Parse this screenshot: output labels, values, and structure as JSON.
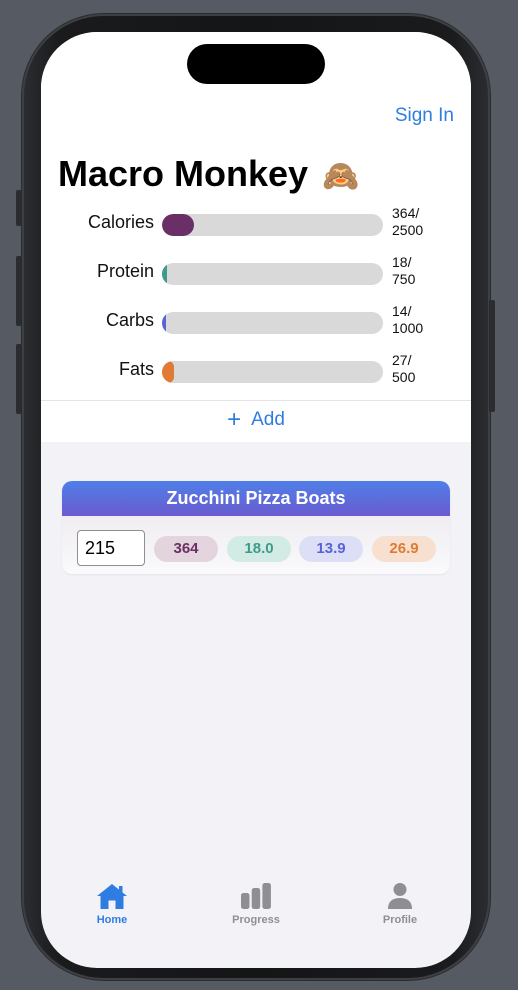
{
  "header": {
    "sign_in_label": "Sign In",
    "app_title": "Macro Monkey",
    "title_emoji": "🙈"
  },
  "macros": [
    {
      "label": "Calories",
      "current": 364,
      "goal": 2500,
      "value_line1": "364/",
      "value_line2": "2500",
      "color": "#6a2f66"
    },
    {
      "label": "Protein",
      "current": 18,
      "goal": 750,
      "value_line1": "18/",
      "value_line2": "750",
      "color": "#3f9a8d"
    },
    {
      "label": "Carbs",
      "current": 14,
      "goal": 1000,
      "value_line1": "14/",
      "value_line2": "1000",
      "color": "#5a63d6"
    },
    {
      "label": "Fats",
      "current": 27,
      "goal": 500,
      "value_line1": "27/",
      "value_line2": "500",
      "color": "#e07a34"
    }
  ],
  "add_button": {
    "label": "Add",
    "icon": "plus-icon"
  },
  "food_entries": [
    {
      "name": "Zucchini Pizza Boats",
      "quantity": "215",
      "calories": "364",
      "protein": "18.0",
      "carbs": "13.9",
      "fats": "26.9"
    }
  ],
  "pill_colors": {
    "calories_bg": "#e3d4de",
    "calories_text": "#6a2f66",
    "protein_bg": "#d3ebe5",
    "protein_text": "#3f9a8d",
    "carbs_bg": "#dcdff5",
    "carbs_text": "#5a63d6",
    "fats_bg": "#f7e0cf",
    "fats_text": "#e07a34"
  },
  "tabs": [
    {
      "label": "Home",
      "icon": "house-icon",
      "active": true
    },
    {
      "label": "Progress",
      "icon": "bar-chart-icon",
      "active": false
    },
    {
      "label": "Profile",
      "icon": "person-icon",
      "active": false
    }
  ],
  "colors": {
    "accent": "#2f7de1",
    "inactive": "#8e8e93"
  }
}
